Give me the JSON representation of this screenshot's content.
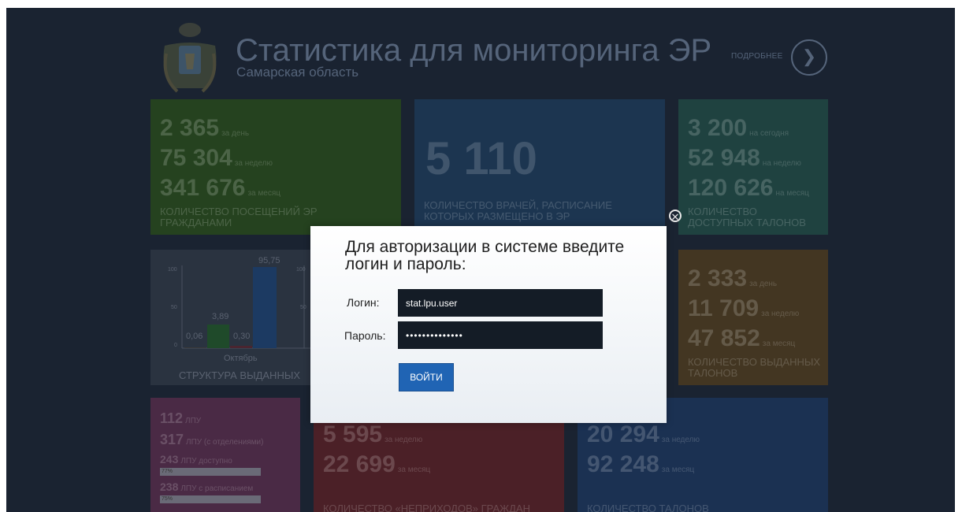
{
  "header": {
    "title": "Статистика для мониторинга ЭР",
    "subtitle": "Самарская область",
    "more_label": "ПОДРОБНЕЕ"
  },
  "tiles": {
    "visits": {
      "rows": [
        {
          "num": "2 365",
          "unit": "за день"
        },
        {
          "num": "75 304",
          "unit": "за неделю"
        },
        {
          "num": "341 676",
          "unit": "за месяц"
        }
      ],
      "caption": "КОЛИЧЕСТВО ПОСЕЩЕНИЙ ЭР ГРАЖДАНАМИ"
    },
    "doctors": {
      "num": "5 110",
      "caption": "КОЛИЧЕСТВО ВРАЧЕЙ, РАСПИСАНИЕ КОТОРЫХ РАЗМЕЩЕНО В ЭР"
    },
    "available": {
      "rows": [
        {
          "num": "3 200",
          "unit": "на сегодня"
        },
        {
          "num": "52 948",
          "unit": "на неделю"
        },
        {
          "num": "120 626",
          "unit": "на месяц"
        }
      ],
      "caption": "КОЛИЧЕСТВО ДОСТУПНЫХ ТАЛОНОВ"
    },
    "structure": {
      "caption": "СТРУКТУРА ВЫДАННЫХ",
      "month": "Октябрь",
      "tick_top": "100",
      "tick_mid": "50",
      "tick_zero": "0",
      "labels": [
        "0,06",
        "3,89",
        "0,30",
        "95,75"
      ]
    },
    "issued": {
      "rows": [
        {
          "num": "2 333",
          "unit": "за день"
        },
        {
          "num": "11 709",
          "unit": "за неделю"
        },
        {
          "num": "47 852",
          "unit": "за месяц"
        }
      ],
      "caption": "КОЛИЧЕСТВО ВЫДАННЫХ ТАЛОНОВ"
    },
    "lpu": {
      "rows": [
        {
          "num": "112",
          "unit": "ЛПУ"
        },
        {
          "num": "317",
          "unit": "ЛПУ (с отделениями)"
        },
        {
          "num": "243",
          "unit": "ЛПУ доступно"
        },
        {
          "num": "238",
          "unit": "ЛПУ с расписанием"
        }
      ],
      "bar1": "77%",
      "bar2": "75%"
    },
    "noshow": {
      "rows": [
        {
          "num": "5 595",
          "unit": "за неделю"
        },
        {
          "num": "22 699",
          "unit": "за месяц"
        }
      ],
      "caption": "КОЛИЧЕСТВО «НЕПРИХОДОВ» ГРАЖДАН"
    },
    "tickets": {
      "rows": [
        {
          "num": "20 294",
          "unit": "за неделю"
        },
        {
          "num": "92 248",
          "unit": "за месяц"
        }
      ],
      "caption": "КОЛИЧЕСТВО ТАЛОНОВ"
    }
  },
  "modal": {
    "title": "Для авторизации в системе введите логин и пароль:",
    "login_label": "Логин:",
    "login_value": "stat.lpu.user",
    "password_label": "Пароль:",
    "password_value": "••••••••••••••",
    "submit_label": "ВОЙТИ",
    "close_glyph": "✕"
  }
}
